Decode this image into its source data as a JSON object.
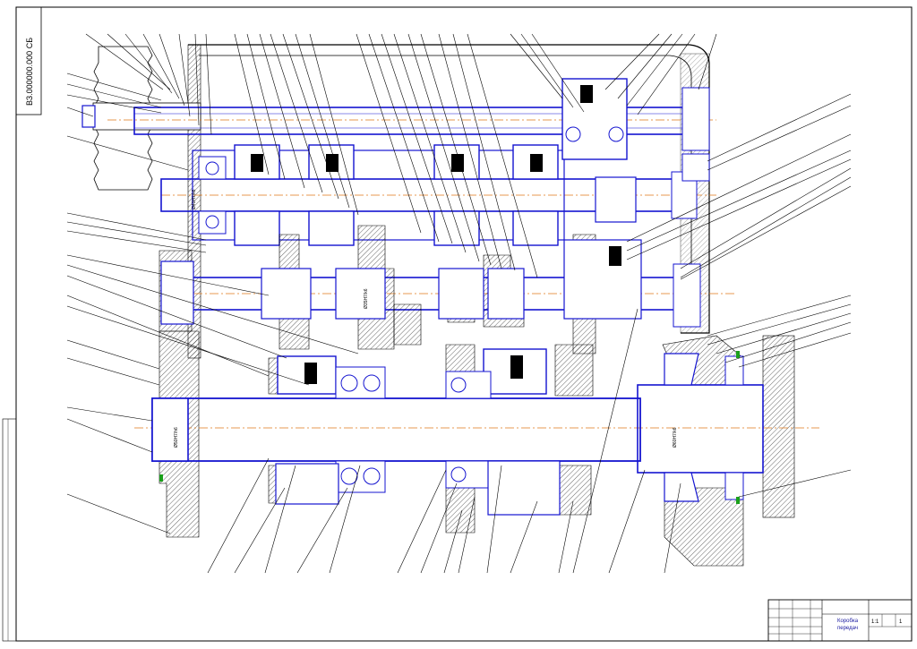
{
  "drawing": {
    "doc_number": "ВЗ.000000.000 СБ",
    "title_block": {
      "name_line1": "Коробка",
      "name_line2": "передач",
      "sheet": "1",
      "sheets": "1",
      "scale": "1:1",
      "mass": ""
    },
    "dimensions": [
      "Ø50H7/h6",
      "Ø40H7/k6",
      "Ø35H7/k6",
      "Ø60H7/k6"
    ],
    "colors": {
      "outline": "#1414d0",
      "axis": "#e07a1a",
      "text": "#000000"
    }
  }
}
